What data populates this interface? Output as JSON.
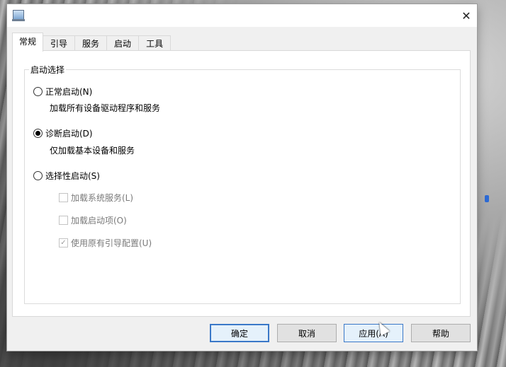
{
  "window": {
    "close_glyph": "✕"
  },
  "tabs": [
    {
      "label": "常规"
    },
    {
      "label": "引导"
    },
    {
      "label": "服务"
    },
    {
      "label": "启动"
    },
    {
      "label": "工具"
    }
  ],
  "startup_group": {
    "title": "启动选择",
    "normal": {
      "label": "正常启动(N)",
      "desc": "加载所有设备驱动程序和服务",
      "checked": false
    },
    "diagnostic": {
      "label": "诊断启动(D)",
      "desc": "仅加载基本设备和服务",
      "checked": true
    },
    "selective": {
      "label": "选择性启动(S)",
      "checked": false
    },
    "options": [
      {
        "label": "加载系统服务(L)",
        "checked": false,
        "enabled": false
      },
      {
        "label": "加载启动项(O)",
        "checked": false,
        "enabled": false
      },
      {
        "label": "使用原有引导配置(U)",
        "checked": true,
        "enabled": false
      }
    ]
  },
  "buttons": {
    "ok": "确定",
    "cancel": "取消",
    "apply": "应用(A)",
    "help": "帮助"
  },
  "colors": {
    "accent": "#3a78c8",
    "window_bg": "#f0f0f0"
  }
}
